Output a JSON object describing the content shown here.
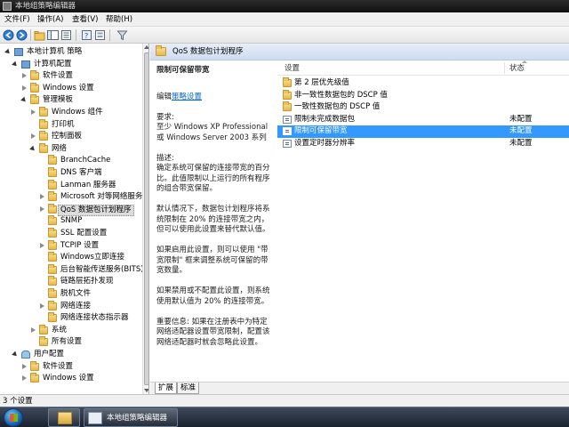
{
  "window": {
    "title": "本地组策略编辑器"
  },
  "menu": [
    "文件(F)",
    "操作(A)",
    "查看(V)",
    "帮助(H)"
  ],
  "toolbar": {
    "icons": [
      "back-icon",
      "forward-icon",
      "up-folder-icon",
      "show-hide-tree-icon",
      "export-icon",
      "help-icon",
      "properties-icon",
      "filter-icon"
    ]
  },
  "tree": {
    "items": [
      {
        "label": "本地计算机 策略",
        "icon": "computer-icon",
        "expander": "expanded"
      },
      {
        "label": "计算机配置",
        "icon": "computer-icon",
        "expander": "expanded"
      },
      {
        "label": "软件设置",
        "icon": "folder-icon",
        "expander": "collapsed"
      },
      {
        "label": "Windows 设置",
        "icon": "folder-icon",
        "expander": "collapsed"
      },
      {
        "label": "管理模板",
        "icon": "folder-icon",
        "expander": "expanded"
      },
      {
        "label": "Windows 组件",
        "icon": "folder-icon",
        "expander": "collapsed"
      },
      {
        "label": "打印机",
        "icon": "folder-icon",
        "expander": "none"
      },
      {
        "label": "控制面板",
        "icon": "folder-icon",
        "expander": "collapsed"
      },
      {
        "label": "网络",
        "icon": "folder-icon",
        "expander": "expanded"
      },
      {
        "label": "BranchCache",
        "icon": "folder-icon",
        "expander": "none"
      },
      {
        "label": "DNS 客户端",
        "icon": "folder-icon",
        "expander": "none"
      },
      {
        "label": "Lanman 服务器",
        "icon": "folder-icon",
        "expander": "none"
      },
      {
        "label": "Microsoft 对等网络服务",
        "icon": "folder-icon",
        "expander": "collapsed"
      },
      {
        "label": "QoS 数据包计划程序",
        "icon": "folder-icon",
        "expander": "collapsed",
        "selected": true
      },
      {
        "label": "SNMP",
        "icon": "folder-icon",
        "expander": "none"
      },
      {
        "label": "SSL 配置设置",
        "icon": "folder-icon",
        "expander": "none"
      },
      {
        "label": "TCPIP 设置",
        "icon": "folder-icon",
        "expander": "collapsed"
      },
      {
        "label": "Windows立即连接",
        "icon": "folder-icon",
        "expander": "none"
      },
      {
        "label": "后台智能传送服务(BITS)",
        "icon": "folder-icon",
        "expander": "none"
      },
      {
        "label": "链路层拓扑发现",
        "icon": "folder-icon",
        "expander": "none"
      },
      {
        "label": "脱机文件",
        "icon": "folder-icon",
        "expander": "none"
      },
      {
        "label": "网络连接",
        "icon": "folder-icon",
        "expander": "collapsed"
      },
      {
        "label": "网络连接状态指示器",
        "icon": "folder-icon",
        "expander": "none"
      },
      {
        "label": "系统",
        "icon": "folder-icon",
        "expander": "collapsed"
      },
      {
        "label": "所有设置",
        "icon": "folder-icon",
        "expander": "none"
      },
      {
        "label": "用户配置",
        "icon": "user-icon",
        "expander": "expanded"
      },
      {
        "label": "软件设置",
        "icon": "folder-icon",
        "expander": "collapsed"
      },
      {
        "label": "Windows 设置",
        "icon": "folder-icon",
        "expander": "collapsed"
      }
    ]
  },
  "pane": {
    "title": "QoS 数据包计划程序"
  },
  "description": {
    "title": "限制可保留带宽",
    "edit_prefix": "编辑",
    "edit_link": "策略设置",
    "requirement_label": "要求:",
    "requirement_text": "至少 Windows XP Professional 或 Windows Server 2003 系列",
    "desc_label": "描述:",
    "desc_text": "确定系统可保留的连接带宽的百分比。此值限制以上运行的所有程序的组合带宽保留。",
    "p2": "默认情况下，数据包计划程序将系统限制在 20% 的连接带宽之内，但可以使用此设置来替代默认值。",
    "p3": "如果启用此设置，则可以使用 \"带宽限制\" 框来调整系统可保留的带宽数量。",
    "p4": "如果禁用或不配置此设置，则系统使用默认值为 20% 的连接带宽。",
    "p5": "重要信息: 如果在注册表中为特定网络适配器设置带宽限制，配置该网络适配器时就会忽略此设置。"
  },
  "list": {
    "columns": {
      "setting": "设置",
      "state": "状态"
    },
    "rows": [
      {
        "name": "第 2 层优先级值",
        "state": "",
        "icon": "folder-icon"
      },
      {
        "name": "非一致性数据包的 DSCP 值",
        "state": "",
        "icon": "folder-icon"
      },
      {
        "name": "一致性数据包的 DSCP 值",
        "state": "",
        "icon": "folder-icon"
      },
      {
        "name": "限制未完成数据包",
        "state": "未配置",
        "icon": "setting-icon"
      },
      {
        "name": "限制可保留带宽",
        "state": "未配置",
        "icon": "setting-icon",
        "selected": true
      },
      {
        "name": "设置定时器分辨率",
        "state": "未配置",
        "icon": "setting-icon"
      }
    ]
  },
  "tabs": [
    "扩展",
    "标准"
  ],
  "status": {
    "text": "3 个设置"
  },
  "taskbar": {
    "apps": [
      {
        "label": "",
        "icon": "explorer-icon"
      },
      {
        "label": "本地组策略编辑器",
        "icon": "gpedit-icon"
      }
    ]
  },
  "colors": {
    "selection": "#3399ff",
    "link": "#0066cc",
    "pane_header": "#dbe6f5"
  }
}
